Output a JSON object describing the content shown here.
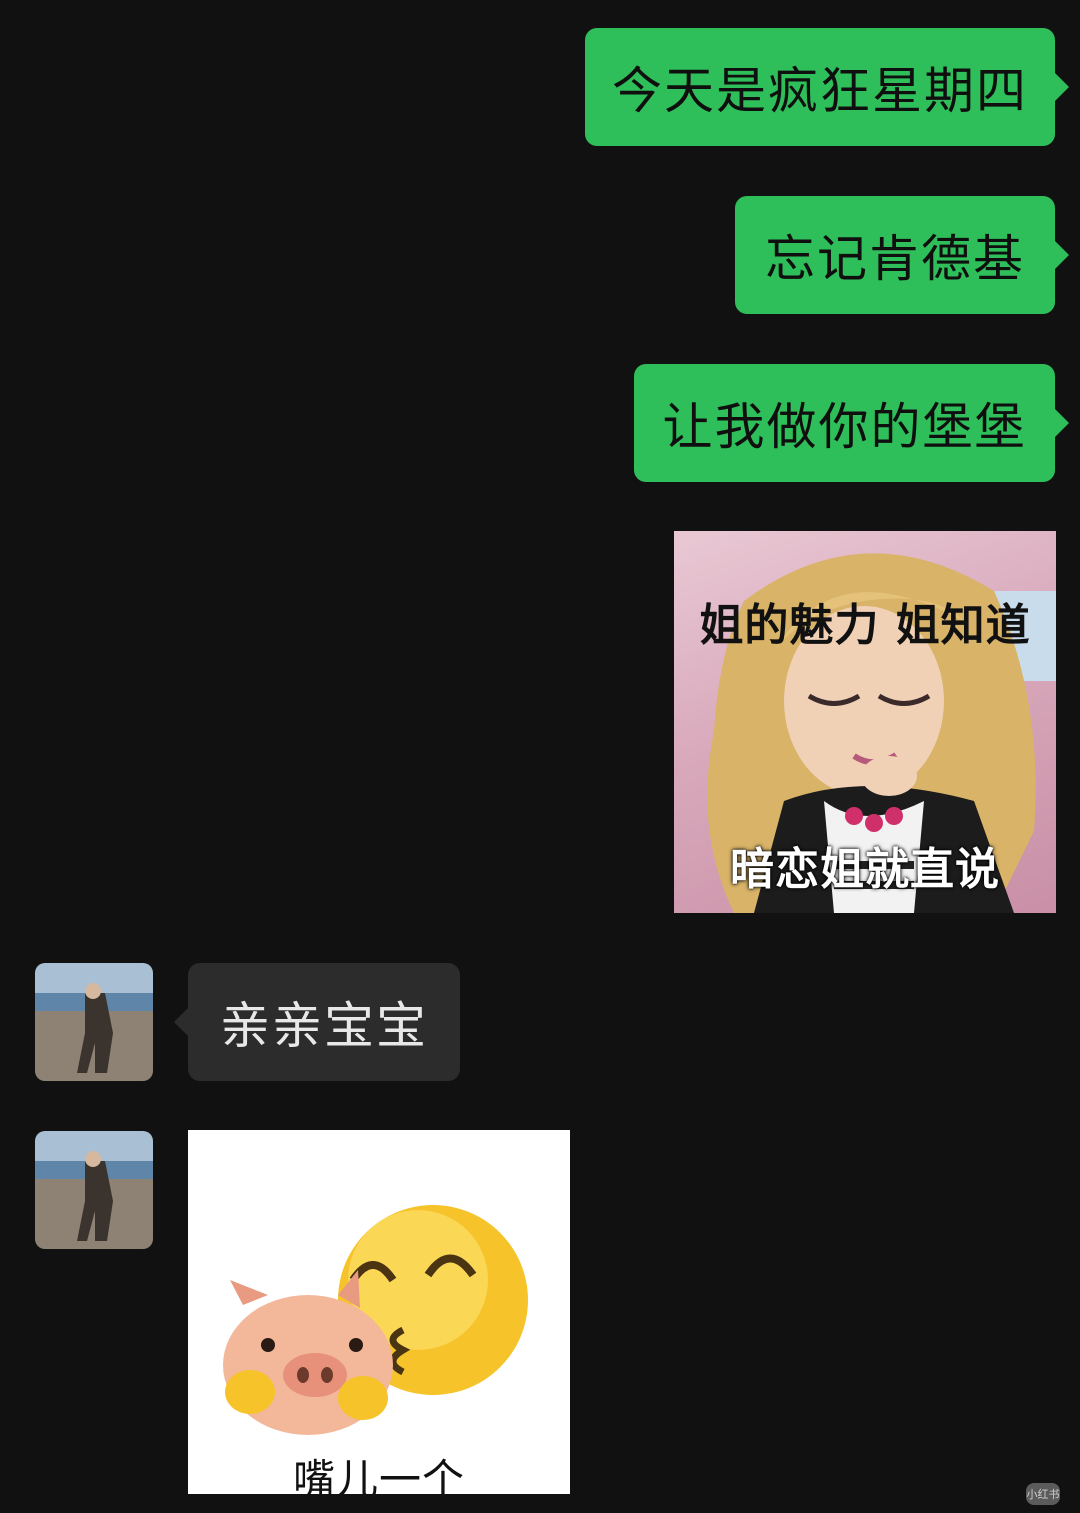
{
  "conversation": {
    "messages": [
      {
        "side": "outgoing",
        "type": "text",
        "text": "今天是疯狂星期四"
      },
      {
        "side": "outgoing",
        "type": "text",
        "text": "忘记肯德基"
      },
      {
        "side": "outgoing",
        "type": "text",
        "text": "让我做你的堡堡"
      },
      {
        "side": "outgoing",
        "type": "sticker",
        "top_text": "姐的魅力 姐知道",
        "bottom_text": "暗恋姐就直说"
      },
      {
        "side": "incoming",
        "type": "text",
        "text": "亲亲宝宝"
      },
      {
        "side": "incoming",
        "type": "sticker",
        "caption": "嘴儿一个"
      }
    ]
  },
  "watermark": {
    "text": "小红书"
  },
  "colors": {
    "background": "#111111",
    "outgoing_bubble": "#2fbf5a",
    "incoming_bubble": "#2c2c2c"
  }
}
